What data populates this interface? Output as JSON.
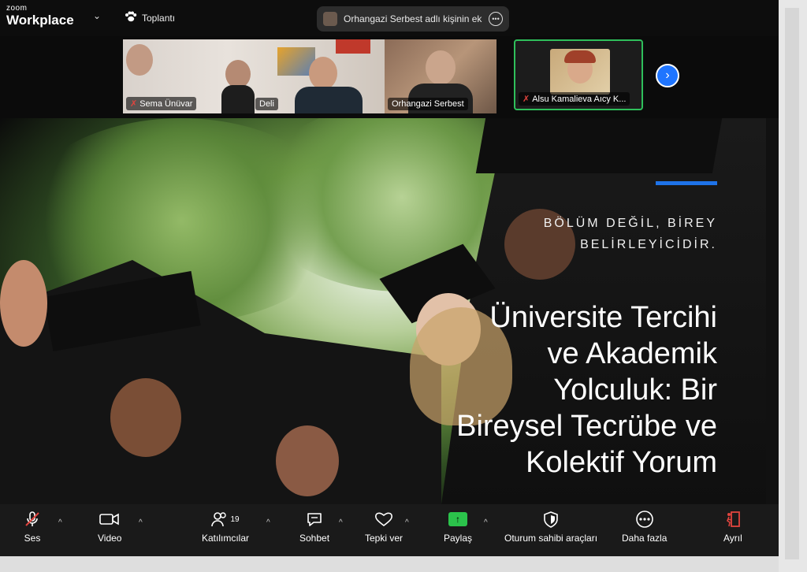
{
  "app": {
    "logo_small": "zoom",
    "logo_big": "Workplace"
  },
  "meeting": {
    "label": "Toplantı"
  },
  "share_pill": {
    "text": "Orhangazi Serbest adlı kişinin ekra"
  },
  "participants": [
    {
      "name": "Sema Ünüvar",
      "muted": true
    },
    {
      "name": "Deli",
      "muted": false
    },
    {
      "name": "Orhangazi Serbest",
      "muted": false
    },
    {
      "name": "Alsu Kamalieva Aıcy K...",
      "muted": true,
      "active_speaker": true
    }
  ],
  "slide": {
    "tagline_line1": "BÖLÜM DEĞİL, BİREY",
    "tagline_line2": "BELİRLEYİCİDİR.",
    "title_lines": [
      "Üniversite Tercihi",
      "ve Akademik",
      "Yolculuk: Bir",
      "Bireysel Tecrübe ve",
      "Kolektif Yorum"
    ]
  },
  "toolbar": {
    "audio": "Ses",
    "video": "Video",
    "participants": "Katılımcılar",
    "participants_count": "19",
    "chat": "Sohbet",
    "react": "Tepki ver",
    "share": "Paylaş",
    "host_tools": "Oturum sahibi araçları",
    "more": "Daha fazla",
    "leave": "Ayrıl"
  },
  "colors": {
    "accent_blue": "#1e73e8",
    "share_green": "#2bc34b",
    "active_border": "#2fbf5b",
    "mute_red": "#e0443e"
  }
}
